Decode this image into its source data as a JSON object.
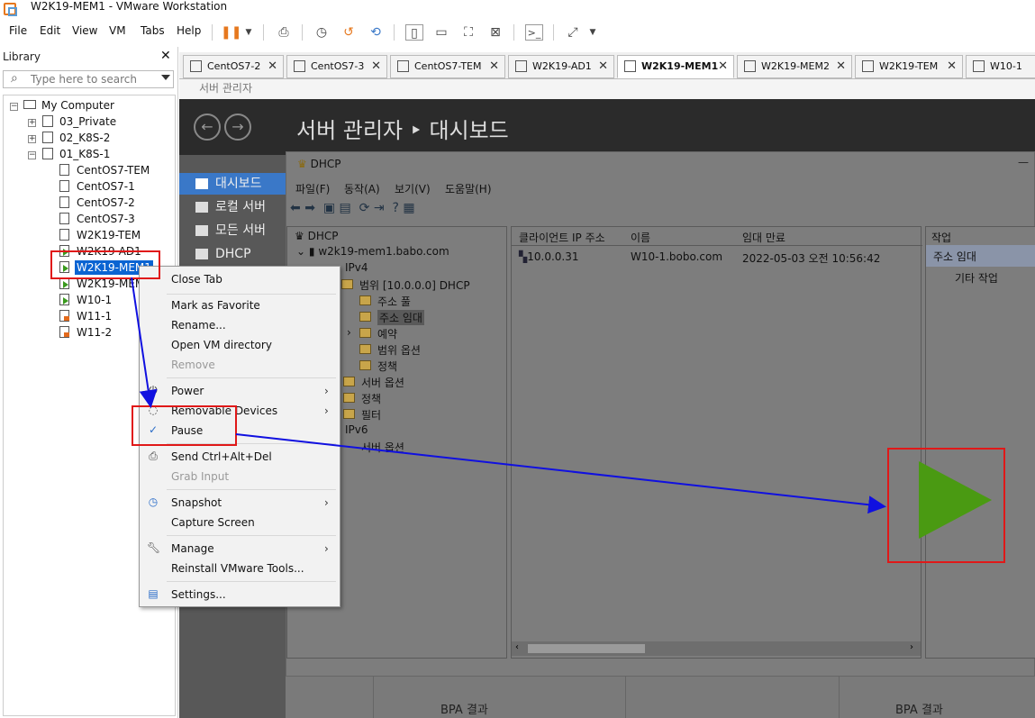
{
  "window": {
    "title": "W2K19-MEM1 - VMware Workstation"
  },
  "menubar": [
    "File",
    "Edit",
    "View",
    "VM",
    "Tabs",
    "Help"
  ],
  "library": {
    "title": "Library",
    "search_placeholder": "Type here to search",
    "root": "My Computer",
    "folders": [
      "03_Private",
      "02_K8S-2",
      "01_K8S-1"
    ],
    "vms": [
      "CentOS7-TEM",
      "CentOS7-1",
      "CentOS7-2",
      "CentOS7-3",
      "W2K19-TEM",
      "W2K19-AD1",
      "W2K19-MEM1",
      "W2K19-MEM",
      "W10-1",
      "W11-1",
      "W11-2"
    ]
  },
  "tabs": [
    "CentOS7-2",
    "CentOS7-3",
    "CentOS7-TEM",
    "W2K19-AD1",
    "W2K19-MEM1",
    "W2K19-MEM2",
    "W2K19-TEM",
    "W10-1"
  ],
  "server_manager": {
    "strip_title": "서버 관리자",
    "header": "서버 관리자 ‣ 대시보드",
    "nav": [
      "대시보드",
      "로컬 서버",
      "모든 서버",
      "DHCP"
    ]
  },
  "dhcp": {
    "title": "DHCP",
    "menu": [
      "파일(F)",
      "동작(A)",
      "보기(V)",
      "도움말(H)"
    ],
    "tree": [
      "DHCP",
      "w2k19-mem1.babo.com",
      "IPv4",
      "범위 [10.0.0.0] DHCP",
      "주소 풀",
      "주소 임대",
      "예약",
      "범위 옵션",
      "정책",
      "서버 옵션",
      "정책",
      "필터",
      "IPv6",
      "서버 옵션"
    ],
    "columns": [
      "클라이언트 IP 주소",
      "이름",
      "임대 만료"
    ],
    "row": {
      "ip": "10.0.0.31",
      "name": "W10-1.bobo.com",
      "expiry": "2022-05-03 오전 10:56:42"
    },
    "actions_header": "작업",
    "actions": [
      "주소 임대",
      "기타 작업"
    ]
  },
  "bpa": {
    "left": "BPA 결과",
    "right": "BPA 결과"
  },
  "context_menu": {
    "items": [
      "Close Tab",
      "Mark as Favorite",
      "Rename...",
      "Open VM directory",
      "Remove",
      "Power",
      "Removable Devices",
      "Pause",
      "Send Ctrl+Alt+Del",
      "Grab Input",
      "Snapshot",
      "Capture Screen",
      "Manage",
      "Reinstall VMware Tools...",
      "Settings..."
    ]
  },
  "colors": {
    "accent": "#0a64d2",
    "annotation_red": "#e01818",
    "annotation_blue": "#1010e0",
    "play_green": "#4a9a12"
  }
}
